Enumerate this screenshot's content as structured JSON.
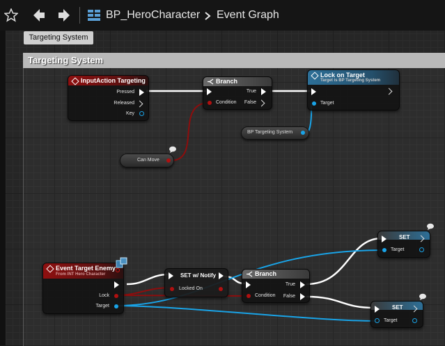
{
  "toolbar": {
    "breadcrumb_blueprint": "BP_HeroCharacter",
    "breadcrumb_graph": "Event Graph"
  },
  "tooltip": "Targeting System",
  "comment": {
    "title": "Targeting System"
  },
  "nodes": {
    "input_action": {
      "title": "InputAction Targeting",
      "pin_pressed": "Pressed",
      "pin_released": "Released",
      "pin_key": "Key"
    },
    "branch_top": {
      "title": "Branch",
      "pin_condition": "Condition",
      "pin_true": "True",
      "pin_false": "False"
    },
    "lock_on": {
      "title": "Lock on Target",
      "subtitle": "Target is BP Targeting System",
      "pin_target": "Target"
    },
    "bp_targeting": {
      "label": "BP Targeting System"
    },
    "can_move": {
      "label": "Can Move"
    },
    "event_target_enemy": {
      "title": "Event Target Enemy",
      "subtitle": "From INT Hero Character",
      "pin_lock": "Lock",
      "pin_target": "Target"
    },
    "set_notify": {
      "title": "SET w/ Notify",
      "pin_locked_on": "Locked On"
    },
    "branch_bottom": {
      "title": "Branch",
      "pin_condition": "Condition",
      "pin_true": "True",
      "pin_false": "False"
    },
    "set_top": {
      "title": "SET",
      "pin_target": "Target"
    },
    "set_bottom": {
      "title": "SET",
      "pin_target": "Target"
    }
  },
  "colors": {
    "event_header": "#8f1010",
    "function_header": "#2d6f97",
    "branch_header": "#5a5a5a",
    "exec_wire": "#ffffff",
    "bool_wire": "#8e0d0d",
    "object_wire": "#19a4e8"
  }
}
